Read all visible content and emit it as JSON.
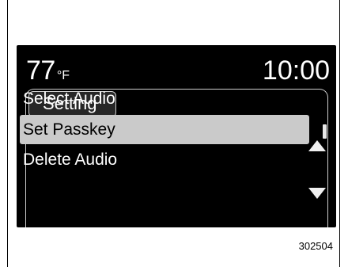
{
  "status_bar": {
    "temperature": "77",
    "temperature_unit": "°F",
    "time": "10:00"
  },
  "menu": {
    "title": "Setting",
    "items": [
      {
        "label": "Select Audio"
      },
      {
        "label": "Set Passkey",
        "selected": true
      },
      {
        "label": "Delete Audio"
      }
    ]
  },
  "icons": {
    "scroll_up": "arrow-up-icon",
    "scroll_down": "arrow-down-icon"
  },
  "figure_id": "302504",
  "colors": {
    "screen_background": "#000000",
    "selected_row": "#cacaca",
    "text": "#ffffff"
  }
}
